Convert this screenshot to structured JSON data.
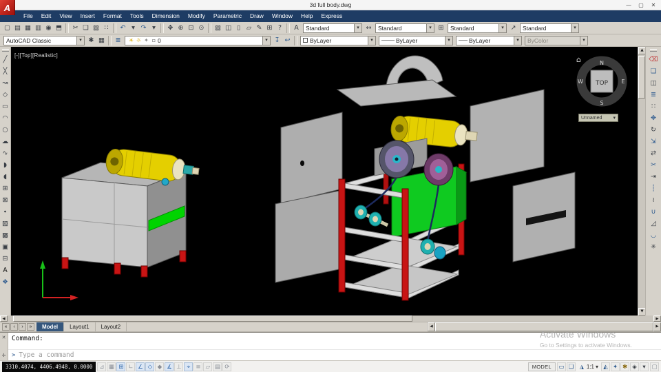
{
  "colors": {
    "brand_red": "#c01a1a",
    "menubar_blue": "#1e3c64",
    "toolbar_gray": "#d6d2ca",
    "viewport_black": "#000000",
    "model_yellow": "#e4cf00",
    "model_green": "#0fca20",
    "frame_red": "#c81414",
    "panel_gray": "#b2b2b2",
    "pulley_teal": "#1fb0b0",
    "disc_purple": "#8678a8",
    "watermark_gray": "#a9a9a9"
  },
  "window": {
    "logo_letter": "A",
    "title": "3d full body.dwg",
    "minimize": "—",
    "maximize": "▢",
    "close": "✕"
  },
  "menubar": {
    "items": [
      "File",
      "Edit",
      "View",
      "Insert",
      "Format",
      "Tools",
      "Dimension",
      "Modify",
      "Parametric",
      "Draw",
      "Window",
      "Help",
      "Express"
    ]
  },
  "toolbar_standard": {
    "icons": [
      {
        "name": "qnew-icon",
        "glyph": "▢"
      },
      {
        "name": "open-icon",
        "glyph": "▤"
      },
      {
        "name": "save-icon",
        "glyph": "▦"
      },
      {
        "name": "plot-icon",
        "glyph": "▥"
      },
      {
        "name": "plot-preview-icon",
        "glyph": "◉"
      },
      {
        "name": "publish-icon",
        "glyph": "⬒"
      },
      {
        "sep": true
      },
      {
        "name": "cut-icon",
        "glyph": "✂"
      },
      {
        "name": "copy-clip-icon",
        "glyph": "❏"
      },
      {
        "name": "paste-icon",
        "glyph": "▨"
      },
      {
        "name": "match-properties-icon",
        "glyph": "∷"
      },
      {
        "sep": true
      },
      {
        "name": "undo-icon",
        "glyph": "↶",
        "color": "#2d5a8e"
      },
      {
        "name": "undo-dropdown-icon",
        "glyph": "▾"
      },
      {
        "name": "redo-icon",
        "glyph": "↷",
        "color": "#2d5a8e"
      },
      {
        "name": "redo-dropdown-icon",
        "glyph": "▾"
      },
      {
        "sep": true
      },
      {
        "name": "pan-icon",
        "glyph": "✥"
      },
      {
        "name": "zoom-realtime-icon",
        "glyph": "⊕"
      },
      {
        "name": "zoom-window-icon",
        "glyph": "⊡"
      },
      {
        "name": "zoom-previous-icon",
        "glyph": "⊙"
      },
      {
        "sep": true
      },
      {
        "name": "properties-icon",
        "glyph": "▧"
      },
      {
        "name": "designcenter-icon",
        "glyph": "◫"
      },
      {
        "name": "tool-palettes-icon",
        "glyph": "▯"
      },
      {
        "name": "sheet-set-manager-icon",
        "glyph": "▱"
      },
      {
        "name": "markup-set-manager-icon",
        "glyph": "✎"
      },
      {
        "name": "quickcalc-icon",
        "glyph": "⊞"
      },
      {
        "name": "help-icon",
        "glyph": "?"
      }
    ],
    "style_groups": [
      {
        "icon": "A",
        "icon_name": "text-style-icon",
        "label": "Standard"
      },
      {
        "icon": "↔",
        "icon_name": "dim-style-icon",
        "label": "Standard"
      },
      {
        "icon": "⊞",
        "icon_name": "table-style-icon",
        "label": "Standard"
      },
      {
        "icon": "↗",
        "icon_name": "multileader-style-icon",
        "label": "Standard"
      }
    ]
  },
  "toolbar_object": {
    "workspace": {
      "value": "AutoCAD Classic"
    },
    "icons": [
      {
        "name": "workspace-settings-icon",
        "glyph": "✱"
      },
      {
        "name": "window-layout-icon",
        "glyph": "▦"
      }
    ],
    "layer_tools": [
      {
        "name": "layer-properties-icon",
        "glyph": "≣",
        "color": "#2d5a8e"
      }
    ],
    "layer_combo": {
      "status_icons": [
        {
          "name": "layer-on-icon",
          "glyph": "☀",
          "color": "#d9a800"
        },
        {
          "name": "layer-thaw-icon",
          "glyph": "☼",
          "color": "#d9a800"
        },
        {
          "name": "layer-unlock-icon",
          "glyph": "✦",
          "color": "#8a8a8a"
        },
        {
          "name": "layer-color-swatch-icon",
          "glyph": "▫",
          "color": "#555555"
        }
      ],
      "value": "0"
    },
    "layer_icons": [
      {
        "name": "make-layer-current-icon",
        "glyph": "↧",
        "color": "#2d5a8e"
      },
      {
        "name": "layer-previous-icon",
        "glyph": "↩",
        "color": "#2d5a8e"
      }
    ],
    "color_combo": {
      "value": "ByLayer"
    },
    "linetype_combo": {
      "swatch": "———",
      "value": "ByLayer"
    },
    "lineweight_combo": {
      "swatch": "——",
      "value": "ByLayer"
    },
    "plotstyle_combo": {
      "value": "ByColor"
    }
  },
  "draw_toolbar": {
    "icons": [
      {
        "name": "line-icon",
        "glyph": "╱"
      },
      {
        "name": "construction-line-icon",
        "glyph": "╳"
      },
      {
        "name": "polyline-icon",
        "glyph": "↝"
      },
      {
        "name": "polygon-icon",
        "glyph": "◇"
      },
      {
        "name": "rectangle-icon",
        "glyph": "▭"
      },
      {
        "name": "arc-icon",
        "glyph": "◠"
      },
      {
        "name": "circle-icon",
        "glyph": "○"
      },
      {
        "name": "revision-cloud-icon",
        "glyph": "☁"
      },
      {
        "name": "spline-icon",
        "glyph": "∿"
      },
      {
        "name": "ellipse-icon",
        "glyph": "◗"
      },
      {
        "name": "ellipse-arc-icon",
        "glyph": "◖"
      },
      {
        "name": "insert-block-icon",
        "glyph": "⊞"
      },
      {
        "name": "make-block-icon",
        "glyph": "⊠"
      },
      {
        "name": "point-icon",
        "glyph": "∙"
      },
      {
        "name": "hatch-icon",
        "glyph": "▨"
      },
      {
        "name": "gradient-icon",
        "glyph": "▩"
      },
      {
        "name": "region-icon",
        "glyph": "▣"
      },
      {
        "name": "table-icon",
        "glyph": "⊟"
      },
      {
        "name": "multiline-text-icon",
        "glyph": "A",
        "color": "#1a1a1a"
      },
      {
        "name": "draw-order-icon",
        "glyph": "❖",
        "color": "#2d5a8e"
      }
    ]
  },
  "modify_toolbar": {
    "icons": [
      {
        "name": "erase-icon",
        "glyph": "⌫",
        "color": "#c24040"
      },
      {
        "name": "copy-icon",
        "glyph": "❏",
        "color": "#2d5a8e"
      },
      {
        "name": "mirror-icon",
        "glyph": "◫",
        "color": "#3a3f46"
      },
      {
        "name": "offset-icon",
        "glyph": "≣",
        "color": "#2d5a8e"
      },
      {
        "name": "array-icon",
        "glyph": "∷",
        "color": "#3a3f46"
      },
      {
        "name": "move-icon",
        "glyph": "✥",
        "color": "#2d5a8e"
      },
      {
        "name": "rotate-icon",
        "glyph": "↻",
        "color": "#3a3f46"
      },
      {
        "name": "scale-icon",
        "glyph": "⇲",
        "color": "#2d5a8e"
      },
      {
        "name": "stretch-icon",
        "glyph": "⇄",
        "color": "#3a3f46"
      },
      {
        "name": "trim-icon",
        "glyph": "✂",
        "color": "#2d5a8e"
      },
      {
        "name": "extend-icon",
        "glyph": "⇥",
        "color": "#3a3f46"
      },
      {
        "name": "break-at-point-icon",
        "glyph": "┆",
        "color": "#2d5a8e"
      },
      {
        "name": "break-icon",
        "glyph": "≀",
        "color": "#3a3f46"
      },
      {
        "name": "join-icon",
        "glyph": "∪",
        "color": "#2d5a8e"
      },
      {
        "name": "chamfer-icon",
        "glyph": "◿",
        "color": "#3a3f46"
      },
      {
        "name": "fillet-icon",
        "glyph": "◡",
        "color": "#2d5a8e"
      },
      {
        "name": "explode-icon",
        "glyph": "✳",
        "color": "#3a3f46"
      }
    ]
  },
  "viewport": {
    "label": "[-][Top][Realistic]",
    "viewcube": {
      "north": "N",
      "east": "E",
      "south": "S",
      "west": "W",
      "face": "TOP",
      "home_icon": "⌂",
      "ucs_chip": "Unnamed",
      "ucs_arrow": "▾"
    }
  },
  "scrollbars": {
    "up": "▲",
    "down": "▼",
    "left": "◀",
    "right": "▶"
  },
  "tabs": {
    "nav": [
      {
        "name": "tab-first-icon",
        "glyph": "«"
      },
      {
        "name": "tab-prev-icon",
        "glyph": "‹"
      },
      {
        "name": "tab-next-icon",
        "glyph": "›"
      },
      {
        "name": "tab-last-icon",
        "glyph": "»"
      }
    ],
    "items": [
      {
        "name": "tab-model",
        "label": "Model",
        "active": true
      },
      {
        "name": "tab-layout1",
        "label": "Layout1"
      },
      {
        "name": "tab-layout2",
        "label": "Layout2"
      }
    ]
  },
  "command": {
    "strip_icons": [
      {
        "name": "command-close-icon",
        "glyph": "✕"
      },
      {
        "name": "command-customize-icon",
        "glyph": "✛"
      }
    ],
    "prompt": "Command:",
    "prompt_mark": ">",
    "hint": "Type a command"
  },
  "statusbar": {
    "coords": "3310.4074, 4406.4948, 0.0000",
    "toggles": [
      {
        "name": "infer-constraints-toggle",
        "glyph": "⊿"
      },
      {
        "name": "snap-mode-toggle",
        "glyph": "▦"
      },
      {
        "name": "grid-display-toggle",
        "glyph": "⊞",
        "active": true
      },
      {
        "name": "ortho-mode-toggle",
        "glyph": "∟"
      },
      {
        "name": "polar-tracking-toggle",
        "glyph": "∠",
        "active": true
      },
      {
        "name": "object-snap-toggle",
        "glyph": "◇",
        "active": true
      },
      {
        "name": "3d-object-snap-toggle",
        "glyph": "◆"
      },
      {
        "name": "object-snap-tracking-toggle",
        "glyph": "∡",
        "active": true
      },
      {
        "name": "dynamic-ucs-toggle",
        "glyph": "⊥"
      },
      {
        "name": "dynamic-input-toggle",
        "glyph": "⌖",
        "active": true
      },
      {
        "name": "lineweight-toggle",
        "glyph": "≡"
      },
      {
        "name": "transparency-toggle",
        "glyph": "▱"
      },
      {
        "name": "quick-properties-toggle",
        "glyph": "▤"
      },
      {
        "name": "selection-cycling-toggle",
        "glyph": "⟳"
      }
    ],
    "model_label": "MODEL",
    "icons_a": [
      {
        "name": "quick-view-layouts-icon",
        "glyph": "▭",
        "color": "#2d5a8e"
      },
      {
        "name": "quick-view-drawings-icon",
        "glyph": "❏",
        "color": "#2d5a8e"
      }
    ],
    "scale": {
      "icon": "◮",
      "value": "1:1",
      "arrow": "▾"
    },
    "icons_b": [
      {
        "name": "annotation-visibility-icon",
        "glyph": "◭",
        "color": "#2d5a8e"
      },
      {
        "name": "annotation-autoscale-icon",
        "glyph": "✦",
        "color": "#2d5a8e"
      },
      {
        "name": "workspace-switching-icon",
        "glyph": "✱",
        "color": "#8a6a10"
      },
      {
        "name": "toolbar-lock-icon",
        "glyph": "◈",
        "color": "#3a3f46"
      },
      {
        "name": "status-menu-icon",
        "glyph": "▾",
        "color": "#3a3f46"
      }
    ],
    "clean_screen": {
      "glyph": "▢"
    }
  },
  "watermark": {
    "title": "Activate Windows",
    "subtitle": "Go to Settings to activate Windows."
  }
}
